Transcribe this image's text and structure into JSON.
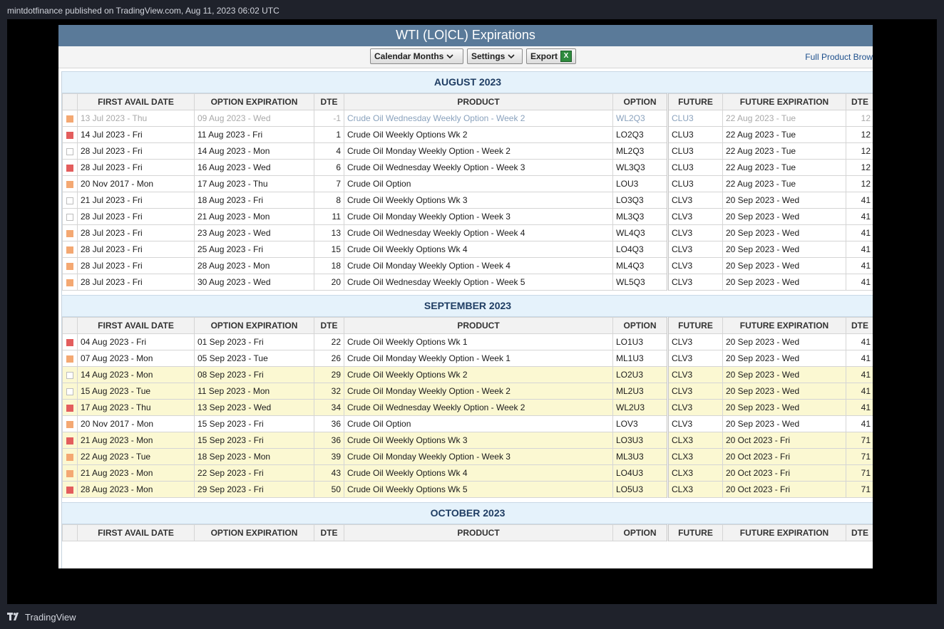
{
  "publication": {
    "text": "mintdotfinance published on TradingView.com, Aug 11, 2023 06:02 UTC"
  },
  "footer": {
    "brand": "TradingView"
  },
  "panel": {
    "title": "WTI (LO|CL) Expirations",
    "toolbar": {
      "calendar_months": "Calendar Months",
      "settings": "Settings",
      "export": "Export",
      "full_product_link": "Full Product Brow"
    }
  },
  "columns": [
    "FIRST AVAIL DATE",
    "OPTION EXPIRATION",
    "DTE",
    "PRODUCT",
    "OPTION",
    "FUTURE",
    "FUTURE EXPIRATION",
    "DTE"
  ],
  "colors": {
    "swatch_orange": "#f4a872",
    "swatch_red": "#e35d5d",
    "swatch_empty": "#ffffff",
    "title_bar": "#5a7a99",
    "highlight_row": "#fbf8d2"
  },
  "sections": [
    {
      "month": "AUGUST 2023",
      "rows": [
        {
          "swatch": "orange",
          "first": "13 Jul 2023 - Thu",
          "exp": "09 Aug 2023 - Wed",
          "dte": "-1",
          "product": "Crude Oil Wednesday Weekly Option - Week 2",
          "option": "WL2Q3",
          "future": "CLU3",
          "fexp": "22 Aug 2023 - Tue",
          "fdte": "12",
          "past": true,
          "hl": false
        },
        {
          "swatch": "red",
          "first": "14 Jul 2023 - Fri",
          "exp": "11 Aug 2023 - Fri",
          "dte": "1",
          "product": "Crude Oil Weekly Options Wk 2",
          "option": "LO2Q3",
          "future": "CLU3",
          "fexp": "22 Aug 2023 - Tue",
          "fdte": "12",
          "past": false,
          "hl": false
        },
        {
          "swatch": "empty",
          "first": "28 Jul 2023 - Fri",
          "exp": "14 Aug 2023 - Mon",
          "dte": "4",
          "product": "Crude Oil Monday Weekly Option - Week 2",
          "option": "ML2Q3",
          "future": "CLU3",
          "fexp": "22 Aug 2023 - Tue",
          "fdte": "12",
          "past": false,
          "hl": false
        },
        {
          "swatch": "red",
          "first": "28 Jul 2023 - Fri",
          "exp": "16 Aug 2023 - Wed",
          "dte": "6",
          "product": "Crude Oil Wednesday Weekly Option - Week 3",
          "option": "WL3Q3",
          "future": "CLU3",
          "fexp": "22 Aug 2023 - Tue",
          "fdte": "12",
          "past": false,
          "hl": false
        },
        {
          "swatch": "orange",
          "first": "20 Nov 2017 - Mon",
          "exp": "17 Aug 2023 - Thu",
          "dte": "7",
          "product": "Crude Oil Option",
          "option": "LOU3",
          "future": "CLU3",
          "fexp": "22 Aug 2023 - Tue",
          "fdte": "12",
          "past": false,
          "hl": false
        },
        {
          "swatch": "empty",
          "first": "21 Jul 2023 - Fri",
          "exp": "18 Aug 2023 - Fri",
          "dte": "8",
          "product": "Crude Oil Weekly Options Wk 3",
          "option": "LO3Q3",
          "future": "CLV3",
          "fexp": "20 Sep 2023 - Wed",
          "fdte": "41",
          "past": false,
          "hl": false
        },
        {
          "swatch": "empty",
          "first": "28 Jul 2023 - Fri",
          "exp": "21 Aug 2023 - Mon",
          "dte": "11",
          "product": "Crude Oil Monday Weekly Option - Week 3",
          "option": "ML3Q3",
          "future": "CLV3",
          "fexp": "20 Sep 2023 - Wed",
          "fdte": "41",
          "past": false,
          "hl": false
        },
        {
          "swatch": "orange",
          "first": "28 Jul 2023 - Fri",
          "exp": "23 Aug 2023 - Wed",
          "dte": "13",
          "product": "Crude Oil Wednesday Weekly Option - Week 4",
          "option": "WL4Q3",
          "future": "CLV3",
          "fexp": "20 Sep 2023 - Wed",
          "fdte": "41",
          "past": false,
          "hl": false
        },
        {
          "swatch": "orange",
          "first": "28 Jul 2023 - Fri",
          "exp": "25 Aug 2023 - Fri",
          "dte": "15",
          "product": "Crude Oil Weekly Options Wk 4",
          "option": "LO4Q3",
          "future": "CLV3",
          "fexp": "20 Sep 2023 - Wed",
          "fdte": "41",
          "past": false,
          "hl": false
        },
        {
          "swatch": "orange",
          "first": "28 Jul 2023 - Fri",
          "exp": "28 Aug 2023 - Mon",
          "dte": "18",
          "product": "Crude Oil Monday Weekly Option - Week 4",
          "option": "ML4Q3",
          "future": "CLV3",
          "fexp": "20 Sep 2023 - Wed",
          "fdte": "41",
          "past": false,
          "hl": false
        },
        {
          "swatch": "orange",
          "first": "28 Jul 2023 - Fri",
          "exp": "30 Aug 2023 - Wed",
          "dte": "20",
          "product": "Crude Oil Wednesday Weekly Option - Week 5",
          "option": "WL5Q3",
          "future": "CLV3",
          "fexp": "20 Sep 2023 - Wed",
          "fdte": "41",
          "past": false,
          "hl": false
        }
      ]
    },
    {
      "month": "SEPTEMBER 2023",
      "rows": [
        {
          "swatch": "red",
          "first": "04 Aug 2023 - Fri",
          "exp": "01 Sep 2023 - Fri",
          "dte": "22",
          "product": "Crude Oil Weekly Options Wk 1",
          "option": "LO1U3",
          "future": "CLV3",
          "fexp": "20 Sep 2023 - Wed",
          "fdte": "41",
          "past": false,
          "hl": false
        },
        {
          "swatch": "orange",
          "first": "07 Aug 2023 - Mon",
          "exp": "05 Sep 2023 - Tue",
          "dte": "26",
          "product": "Crude Oil Monday Weekly Option - Week 1",
          "option": "ML1U3",
          "future": "CLV3",
          "fexp": "20 Sep 2023 - Wed",
          "fdte": "41",
          "past": false,
          "hl": false
        },
        {
          "swatch": "empty",
          "first": "14 Aug 2023 - Mon",
          "exp": "08 Sep 2023 - Fri",
          "dte": "29",
          "product": "Crude Oil Weekly Options Wk 2",
          "option": "LO2U3",
          "future": "CLV3",
          "fexp": "20 Sep 2023 - Wed",
          "fdte": "41",
          "past": false,
          "hl": true
        },
        {
          "swatch": "empty",
          "first": "15 Aug 2023 - Tue",
          "exp": "11 Sep 2023 - Mon",
          "dte": "32",
          "product": "Crude Oil Monday Weekly Option - Week 2",
          "option": "ML2U3",
          "future": "CLV3",
          "fexp": "20 Sep 2023 - Wed",
          "fdte": "41",
          "past": false,
          "hl": true
        },
        {
          "swatch": "red",
          "first": "17 Aug 2023 - Thu",
          "exp": "13 Sep 2023 - Wed",
          "dte": "34",
          "product": "Crude Oil Wednesday Weekly Option - Week 2",
          "option": "WL2U3",
          "future": "CLV3",
          "fexp": "20 Sep 2023 - Wed",
          "fdte": "41",
          "past": false,
          "hl": true
        },
        {
          "swatch": "orange",
          "first": "20 Nov 2017 - Mon",
          "exp": "15 Sep 2023 - Fri",
          "dte": "36",
          "product": "Crude Oil Option",
          "option": "LOV3",
          "future": "CLV3",
          "fexp": "20 Sep 2023 - Wed",
          "fdte": "41",
          "past": false,
          "hl": false
        },
        {
          "swatch": "red",
          "first": "21 Aug 2023 - Mon",
          "exp": "15 Sep 2023 - Fri",
          "dte": "36",
          "product": "Crude Oil Weekly Options Wk 3",
          "option": "LO3U3",
          "future": "CLX3",
          "fexp": "20 Oct 2023 - Fri",
          "fdte": "71",
          "past": false,
          "hl": true
        },
        {
          "swatch": "orange",
          "first": "22 Aug 2023 - Tue",
          "exp": "18 Sep 2023 - Mon",
          "dte": "39",
          "product": "Crude Oil Monday Weekly Option - Week 3",
          "option": "ML3U3",
          "future": "CLX3",
          "fexp": "20 Oct 2023 - Fri",
          "fdte": "71",
          "past": false,
          "hl": true
        },
        {
          "swatch": "orange",
          "first": "21 Aug 2023 - Mon",
          "exp": "22 Sep 2023 - Fri",
          "dte": "43",
          "product": "Crude Oil Weekly Options Wk 4",
          "option": "LO4U3",
          "future": "CLX3",
          "fexp": "20 Oct 2023 - Fri",
          "fdte": "71",
          "past": false,
          "hl": true
        },
        {
          "swatch": "red",
          "first": "28 Aug 2023 - Mon",
          "exp": "29 Sep 2023 - Fri",
          "dte": "50",
          "product": "Crude Oil Weekly Options Wk 5",
          "option": "LO5U3",
          "future": "CLX3",
          "fexp": "20 Oct 2023 - Fri",
          "fdte": "71",
          "past": false,
          "hl": true
        }
      ]
    },
    {
      "month": "OCTOBER 2023",
      "rows": []
    }
  ]
}
